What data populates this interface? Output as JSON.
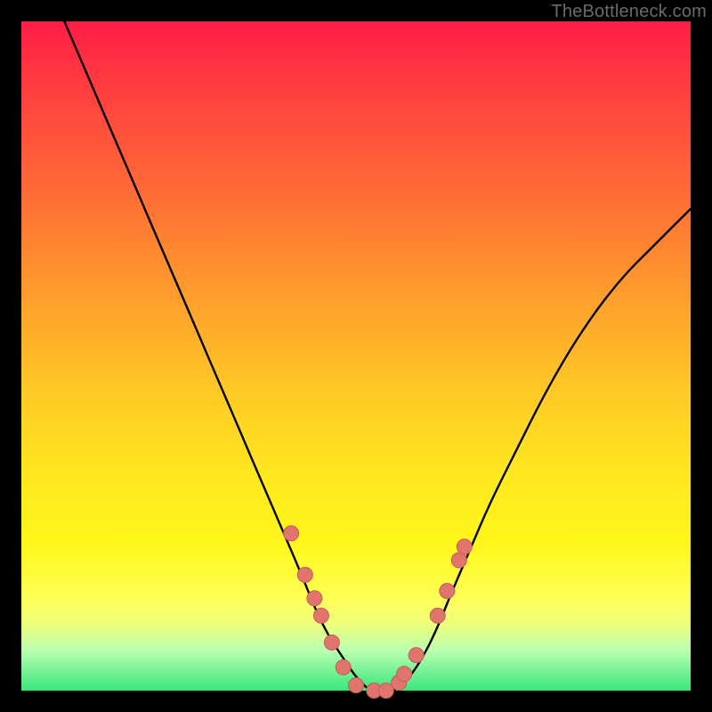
{
  "watermark": "TheBottleneck.com",
  "colors": {
    "frame": "#000000",
    "curve": "#000000",
    "dot_fill": "#e2746e",
    "dot_stroke": "#c25f5a"
  },
  "chart_data": {
    "type": "line",
    "title": "",
    "xlabel": "",
    "ylabel": "",
    "xlim": [
      0,
      100
    ],
    "ylim": [
      0,
      100
    ],
    "series": [
      {
        "name": "bottleneck-curve",
        "x": [
          0,
          3,
          6,
          9,
          12,
          15,
          18,
          21,
          24,
          27,
          30,
          33,
          36,
          39,
          42,
          44,
          46,
          48,
          50,
          52,
          54,
          56,
          58,
          60,
          62,
          64,
          67,
          70,
          74,
          78,
          82,
          86,
          90,
          94,
          98,
          100
        ],
        "y": [
          115,
          108,
          101,
          94,
          87,
          80,
          73,
          66,
          59,
          52,
          45,
          38,
          31,
          24,
          17,
          12,
          8,
          5,
          2,
          0,
          0,
          0,
          2,
          5,
          9,
          14,
          21,
          28,
          36,
          44,
          51,
          57,
          62,
          66,
          70,
          72
        ]
      }
    ],
    "dots": {
      "name": "highlight-dots",
      "x": [
        40.3,
        42.4,
        43.8,
        44.8,
        46.4,
        48.1,
        50.0,
        52.7,
        54.5,
        56.4,
        57.2,
        59.0,
        62.2,
        63.6,
        65.4,
        66.2
      ],
      "y": [
        23.5,
        17.3,
        13.8,
        11.2,
        7.2,
        3.5,
        0.8,
        0.0,
        0.0,
        1.2,
        2.5,
        5.3,
        11.2,
        14.9,
        19.5,
        21.5
      ]
    }
  }
}
